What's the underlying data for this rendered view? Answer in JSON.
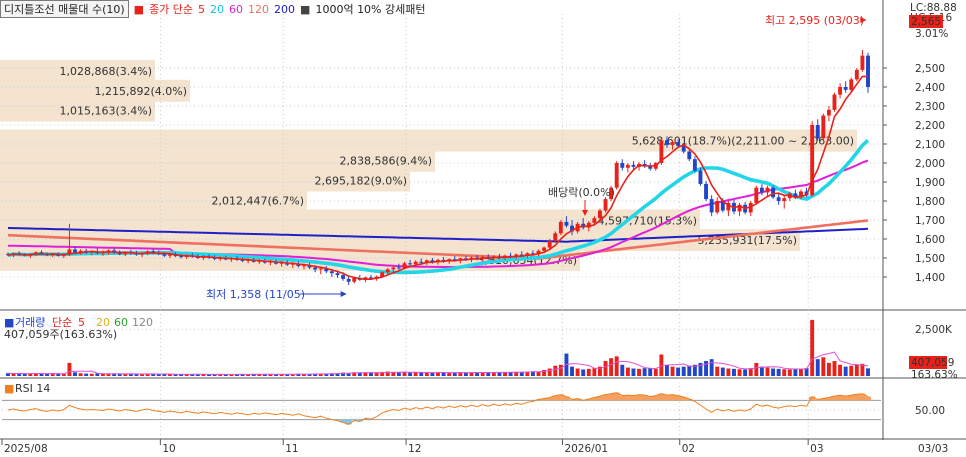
{
  "header": {
    "indicator_name": "디지틀조선 매물대 수(10)",
    "ma_label": "종가 단순",
    "ma_periods": [
      "5",
      "20",
      "60",
      "120",
      "200"
    ],
    "pattern_label": "1000억 10% 강세패턴"
  },
  "colors": {
    "up": "#e8221a",
    "down": "#2146c8",
    "ma5": "#e8221a",
    "ma20": "#22d6e8",
    "ma60": "#e020d8",
    "ma120": "#f07060",
    "ma200": "#2020c8",
    "volume_profile": "#f3e3cf",
    "rsi": "#f08020"
  },
  "price_axis": {
    "ticks": [
      "2,500",
      "2,400",
      "2,300",
      "2,200",
      "2,100",
      "2,000",
      "1,900",
      "1,800",
      "1,700",
      "1,600",
      "1,500",
      "1,400"
    ],
    "top_labels": [
      "LC:88.88",
      "HC:5.16"
    ],
    "current_price": "2,565",
    "current_change": "3.01%"
  },
  "volume_profile": [
    {
      "price": 2484,
      "text": "1,028,868(3.4%)"
    },
    {
      "price": 2380,
      "text": "1,215,892(4.0%)"
    },
    {
      "price": 2276,
      "text": "1,015,163(3.4%)"
    },
    {
      "price": 2118,
      "text": "5,628,601(18.7%)(2,211.00 ~ 2,063.00)"
    },
    {
      "price": 2012,
      "text": "2,838,586(9.4%)"
    },
    {
      "price": 1908,
      "text": "2,695,182(9.0%)"
    },
    {
      "price": 1802,
      "text": "2,012,447(6.7%)"
    },
    {
      "price": 1698,
      "text": "4,597,710(15.3%)"
    },
    {
      "price": 1594,
      "text": "5,255,931(17.5%)"
    },
    {
      "price": 1490,
      "text": "3,810,654(12.7%)"
    }
  ],
  "annotations": {
    "high": "최고 2,595 (03/03)",
    "low": "최저 1,358 (11/05)",
    "dividend": "배당락(0.0%)"
  },
  "volume_panel": {
    "title": "거래량",
    "ma_label": "단순",
    "ma_periods": [
      "5",
      "20",
      "60",
      "120"
    ],
    "current": "407,059주(163.63%)",
    "tick": "2,500K",
    "current_value": "407,059",
    "current_pct": "163.63%"
  },
  "rsi_panel": {
    "title": "RSI 14",
    "tick": "50.00"
  },
  "time_axis": {
    "labels": [
      "2025/08",
      "10",
      "11",
      "12",
      "2026/01",
      "02",
      "03"
    ],
    "right_label": "03/03"
  },
  "chart_data": {
    "type": "candlestick",
    "price_range": [
      1300,
      2600
    ],
    "volume_max_k": 3100,
    "rsi_range": [
      0,
      100
    ],
    "candles": [
      [
        1520,
        1530,
        1510,
        1515
      ],
      [
        1515,
        1528,
        1505,
        1525
      ],
      [
        1525,
        1535,
        1512,
        1518
      ],
      [
        1518,
        1525,
        1508,
        1512
      ],
      [
        1512,
        1524,
        1500,
        1520
      ],
      [
        1520,
        1535,
        1512,
        1530
      ],
      [
        1530,
        1540,
        1518,
        1522
      ],
      [
        1522,
        1530,
        1510,
        1515
      ],
      [
        1515,
        1526,
        1505,
        1520
      ],
      [
        1520,
        1530,
        1508,
        1512
      ],
      [
        1512,
        1525,
        1500,
        1518
      ],
      [
        1518,
        1680,
        1510,
        1545
      ],
      [
        1545,
        1560,
        1525,
        1530
      ],
      [
        1530,
        1545,
        1518,
        1538
      ],
      [
        1538,
        1548,
        1522,
        1528
      ],
      [
        1528,
        1540,
        1515,
        1535
      ],
      [
        1535,
        1550,
        1520,
        1525
      ],
      [
        1525,
        1540,
        1512,
        1530
      ],
      [
        1530,
        1545,
        1518,
        1540
      ],
      [
        1540,
        1552,
        1522,
        1528
      ],
      [
        1528,
        1540,
        1515,
        1520
      ],
      [
        1520,
        1535,
        1510,
        1530
      ],
      [
        1530,
        1542,
        1518,
        1525
      ],
      [
        1525,
        1538,
        1512,
        1518
      ],
      [
        1518,
        1530,
        1505,
        1525
      ],
      [
        1525,
        1540,
        1515,
        1535
      ],
      [
        1535,
        1548,
        1520,
        1528
      ],
      [
        1528,
        1540,
        1515,
        1520
      ],
      [
        1520,
        1532,
        1505,
        1512
      ],
      [
        1512,
        1525,
        1500,
        1518
      ],
      [
        1518,
        1530,
        1505,
        1510
      ],
      [
        1510,
        1522,
        1498,
        1505
      ],
      [
        1505,
        1520,
        1495,
        1512
      ],
      [
        1512,
        1525,
        1500,
        1508
      ],
      [
        1508,
        1520,
        1495,
        1500
      ],
      [
        1500,
        1515,
        1490,
        1506
      ],
      [
        1506,
        1518,
        1495,
        1502
      ],
      [
        1502,
        1514,
        1488,
        1495
      ],
      [
        1495,
        1508,
        1485,
        1500
      ],
      [
        1500,
        1512,
        1488,
        1492
      ],
      [
        1492,
        1505,
        1480,
        1498
      ],
      [
        1498,
        1510,
        1485,
        1490
      ],
      [
        1490,
        1502,
        1478,
        1485
      ],
      [
        1485,
        1498,
        1472,
        1490
      ],
      [
        1490,
        1500,
        1475,
        1480
      ],
      [
        1480,
        1494,
        1468,
        1486
      ],
      [
        1486,
        1496,
        1470,
        1476
      ],
      [
        1476,
        1490,
        1462,
        1482
      ],
      [
        1482,
        1492,
        1465,
        1470
      ],
      [
        1470,
        1484,
        1455,
        1475
      ],
      [
        1475,
        1488,
        1458,
        1465
      ],
      [
        1465,
        1478,
        1448,
        1470
      ],
      [
        1470,
        1482,
        1450,
        1458
      ],
      [
        1458,
        1470,
        1440,
        1462
      ],
      [
        1462,
        1475,
        1442,
        1450
      ],
      [
        1450,
        1462,
        1425,
        1440
      ],
      [
        1440,
        1455,
        1415,
        1445
      ],
      [
        1445,
        1458,
        1420,
        1430
      ],
      [
        1430,
        1442,
        1400,
        1420
      ],
      [
        1420,
        1435,
        1395,
        1410
      ],
      [
        1410,
        1425,
        1380,
        1390
      ],
      [
        1390,
        1405,
        1358,
        1375
      ],
      [
        1375,
        1400,
        1365,
        1395
      ],
      [
        1395,
        1410,
        1380,
        1385
      ],
      [
        1385,
        1402,
        1372,
        1398
      ],
      [
        1398,
        1412,
        1385,
        1390
      ],
      [
        1390,
        1408,
        1380,
        1402
      ],
      [
        1402,
        1430,
        1395,
        1425
      ],
      [
        1425,
        1448,
        1415,
        1440
      ],
      [
        1440,
        1458,
        1425,
        1450
      ],
      [
        1450,
        1470,
        1438,
        1445
      ],
      [
        1445,
        1480,
        1440,
        1472
      ],
      [
        1472,
        1490,
        1458,
        1468
      ],
      [
        1468,
        1488,
        1455,
        1480
      ],
      [
        1480,
        1498,
        1465,
        1475
      ],
      [
        1475,
        1492,
        1462,
        1488
      ],
      [
        1488,
        1500,
        1470,
        1478
      ],
      [
        1478,
        1495,
        1465,
        1490
      ],
      [
        1490,
        1505,
        1475,
        1482
      ],
      [
        1482,
        1498,
        1470,
        1494
      ],
      [
        1494,
        1510,
        1480,
        1486
      ],
      [
        1486,
        1502,
        1472,
        1498
      ],
      [
        1498,
        1512,
        1485,
        1492
      ],
      [
        1492,
        1508,
        1478,
        1502
      ],
      [
        1502,
        1515,
        1488,
        1495
      ],
      [
        1495,
        1512,
        1482,
        1505
      ],
      [
        1505,
        1520,
        1490,
        1498
      ],
      [
        1498,
        1515,
        1485,
        1508
      ],
      [
        1508,
        1522,
        1495,
        1502
      ],
      [
        1502,
        1518,
        1490,
        1512
      ],
      [
        1512,
        1528,
        1498,
        1506
      ],
      [
        1506,
        1524,
        1495,
        1518
      ],
      [
        1518,
        1535,
        1505,
        1512
      ],
      [
        1512,
        1530,
        1500,
        1525
      ],
      [
        1525,
        1540,
        1512,
        1520
      ],
      [
        1520,
        1545,
        1510,
        1538
      ],
      [
        1538,
        1560,
        1525,
        1555
      ],
      [
        1555,
        1600,
        1545,
        1590
      ],
      [
        1590,
        1640,
        1580,
        1630
      ],
      [
        1630,
        1700,
        1620,
        1690
      ],
      [
        1690,
        1720,
        1660,
        1670
      ],
      [
        1670,
        1700,
        1620,
        1640
      ],
      [
        1640,
        1690,
        1630,
        1680
      ],
      [
        1680,
        1710,
        1650,
        1660
      ],
      [
        1660,
        1695,
        1640,
        1685
      ],
      [
        1685,
        1720,
        1670,
        1710
      ],
      [
        1710,
        1760,
        1700,
        1750
      ],
      [
        1750,
        1820,
        1740,
        1810
      ],
      [
        1810,
        1880,
        1800,
        1870
      ],
      [
        1870,
        2010,
        1860,
        2000
      ],
      [
        2000,
        2020,
        1960,
        1975
      ],
      [
        1975,
        2000,
        1950,
        1990
      ],
      [
        1990,
        2010,
        1965,
        1980
      ],
      [
        1980,
        2005,
        1960,
        1995
      ],
      [
        1995,
        2015,
        1975,
        1985
      ],
      [
        1985,
        2000,
        1960,
        1970
      ],
      [
        1970,
        2005,
        1960,
        2000
      ],
      [
        2000,
        2130,
        1990,
        2120
      ],
      [
        2120,
        2140,
        2080,
        2095
      ],
      [
        2095,
        2120,
        2070,
        2110
      ],
      [
        2110,
        2125,
        2080,
        2090
      ],
      [
        2090,
        2105,
        2050,
        2060
      ],
      [
        2060,
        2080,
        2010,
        2020
      ],
      [
        2020,
        2035,
        1950,
        1960
      ],
      [
        1960,
        1975,
        1880,
        1890
      ],
      [
        1890,
        1905,
        1800,
        1810
      ],
      [
        1810,
        1830,
        1720,
        1740
      ],
      [
        1740,
        1820,
        1730,
        1800
      ],
      [
        1800,
        1815,
        1740,
        1750
      ],
      [
        1750,
        1800,
        1720,
        1790
      ],
      [
        1790,
        1805,
        1730,
        1745
      ],
      [
        1745,
        1790,
        1720,
        1780
      ],
      [
        1780,
        1795,
        1730,
        1740
      ],
      [
        1740,
        1800,
        1720,
        1790
      ],
      [
        1790,
        1880,
        1780,
        1870
      ],
      [
        1870,
        1890,
        1830,
        1845
      ],
      [
        1845,
        1880,
        1820,
        1870
      ],
      [
        1870,
        1880,
        1810,
        1820
      ],
      [
        1820,
        1840,
        1780,
        1800
      ],
      [
        1800,
        1830,
        1760,
        1815
      ],
      [
        1815,
        1850,
        1800,
        1840
      ],
      [
        1840,
        1860,
        1810,
        1820
      ],
      [
        1820,
        1860,
        1810,
        1850
      ],
      [
        1850,
        1870,
        1820,
        1830
      ],
      [
        1830,
        2220,
        1825,
        2200
      ],
      [
        2200,
        2230,
        2120,
        2130
      ],
      [
        2130,
        2260,
        2120,
        2250
      ],
      [
        2250,
        2300,
        2220,
        2280
      ],
      [
        2280,
        2370,
        2270,
        2360
      ],
      [
        2360,
        2420,
        2340,
        2400
      ],
      [
        2400,
        2430,
        2370,
        2385
      ],
      [
        2385,
        2450,
        2375,
        2440
      ],
      [
        2440,
        2500,
        2430,
        2490
      ],
      [
        2490,
        2595,
        2480,
        2565
      ],
      [
        2565,
        2580,
        2370,
        2400
      ]
    ],
    "volumes_k": [
      150,
      120,
      130,
      110,
      140,
      160,
      120,
      110,
      130,
      120,
      110,
      700,
      200,
      150,
      130,
      120,
      140,
      110,
      120,
      130,
      100,
      110,
      120,
      100,
      110,
      130,
      100,
      90,
      110,
      100,
      90,
      100,
      80,
      90,
      100,
      80,
      90,
      80,
      100,
      90,
      80,
      90,
      100,
      80,
      110,
      90,
      100,
      80,
      90,
      110,
      90,
      100,
      120,
      100,
      90,
      130,
      110,
      120,
      140,
      150,
      180,
      160,
      200,
      190,
      170,
      180,
      160,
      220,
      240,
      200,
      190,
      210,
      180,
      200,
      190,
      170,
      180,
      200,
      190,
      180,
      170,
      190,
      180,
      200,
      190,
      170,
      200,
      180,
      210,
      190,
      200,
      220,
      210,
      230,
      250,
      240,
      320,
      400,
      550,
      600,
      1200,
      500,
      400,
      350,
      380,
      420,
      500,
      800,
      950,
      1050,
      600,
      450,
      400,
      380,
      420,
      400,
      380,
      1150,
      600,
      500,
      450,
      500,
      550,
      600,
      700,
      800,
      900,
      500,
      450,
      400,
      380,
      360,
      350,
      420,
      700,
      500,
      450,
      400,
      380,
      360,
      350,
      380,
      400,
      420,
      3000,
      900,
      1000,
      700,
      800,
      600,
      500,
      550,
      600,
      650,
      407
    ],
    "rsi": [
      50,
      52,
      49,
      48,
      51,
      53,
      49,
      47,
      50,
      48,
      51,
      60,
      55,
      52,
      50,
      51,
      50,
      49,
      52,
      50,
      48,
      51,
      49,
      47,
      50,
      52,
      49,
      47,
      45,
      48,
      46,
      44,
      47,
      45,
      43,
      46,
      44,
      42,
      45,
      43,
      41,
      44,
      42,
      40,
      43,
      41,
      44,
      42,
      40,
      43,
      41,
      39,
      42,
      38,
      36,
      34,
      37,
      33,
      30,
      28,
      24,
      20,
      28,
      26,
      33,
      31,
      36,
      44,
      48,
      51,
      49,
      54,
      51,
      55,
      52,
      56,
      53,
      57,
      54,
      58,
      55,
      59,
      56,
      60,
      57,
      61,
      58,
      62,
      59,
      63,
      60,
      64,
      62,
      66,
      68,
      72,
      74,
      76,
      80,
      82,
      78,
      72,
      74,
      70,
      73,
      76,
      79,
      82,
      84,
      86,
      80,
      81,
      80,
      82,
      81,
      78,
      80,
      84,
      81,
      82,
      80,
      77,
      73,
      68,
      60,
      52,
      45,
      52,
      48,
      51,
      47,
      50,
      48,
      52,
      62,
      58,
      60,
      56,
      54,
      57,
      59,
      57,
      60,
      58,
      78,
      72,
      74,
      76,
      79,
      81,
      79,
      81,
      83,
      84,
      78
    ],
    "ma200_endpoints": [
      1655,
      1640
    ]
  }
}
